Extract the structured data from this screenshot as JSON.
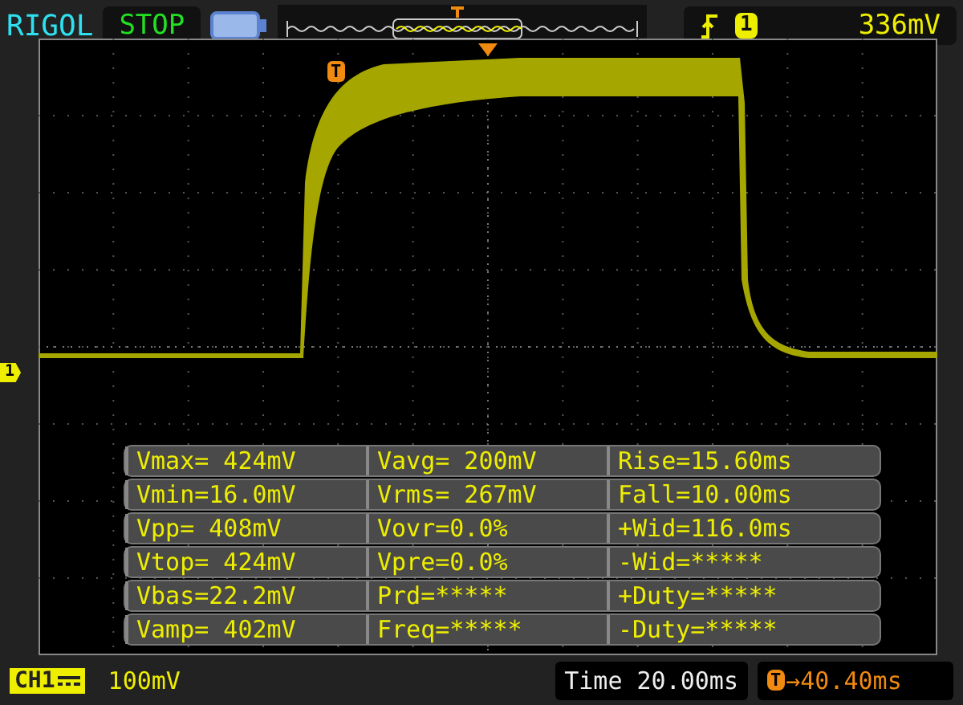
{
  "header": {
    "brand": "RIGOL",
    "run_state": "STOP",
    "trigger": {
      "source": "1",
      "level": "336mV"
    }
  },
  "display": {
    "trigger_marker": "T",
    "channel_marker": "1",
    "measurements": [
      [
        "Vmax= 424mV",
        "Vavg= 200mV",
        "Rise=15.60ms"
      ],
      [
        "Vmin=16.0mV",
        "Vrms= 267mV",
        "Fall=10.00ms"
      ],
      [
        "Vpp= 408mV",
        "Vovr=0.0%",
        "+Wid=116.0ms"
      ],
      [
        "Vtop= 424mV",
        "Vpre=0.0%",
        "-Wid=*****"
      ],
      [
        "Vbas=22.2mV",
        "Prd=*****",
        "+Duty=*****"
      ],
      [
        "Vamp= 402mV",
        "Freq=*****",
        "-Duty=*****"
      ]
    ]
  },
  "footer": {
    "channel": "CH1",
    "scale": "100mV",
    "timebase": "Time 20.00ms",
    "trigger_marker": "T",
    "offset": "→40.40ms"
  }
}
